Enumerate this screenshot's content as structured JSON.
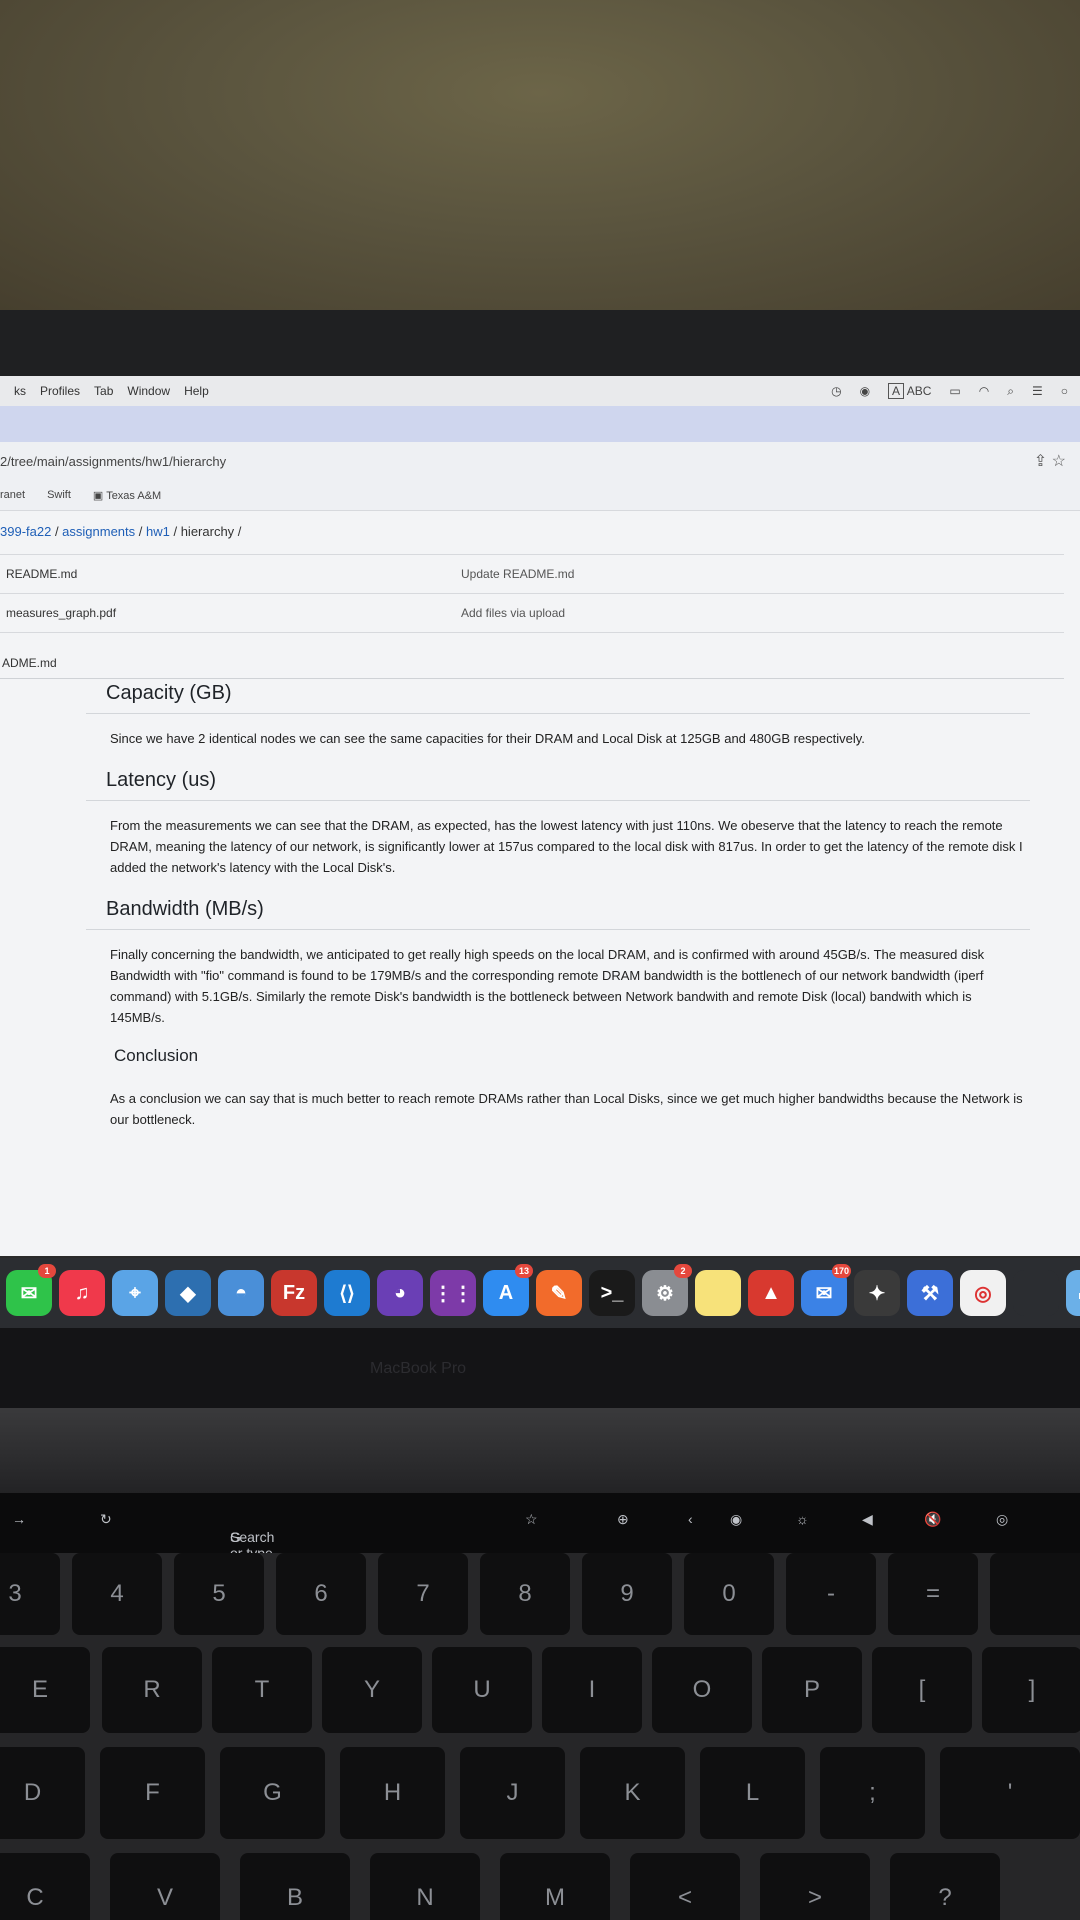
{
  "menubar": {
    "items": [
      "ks",
      "Profiles",
      "Tab",
      "Window",
      "Help"
    ],
    "input_label": "ABC"
  },
  "urlbar": {
    "url": "2/tree/main/assignments/hw1/hierarchy"
  },
  "bookmarks": [
    "ranet",
    "Swift",
    "Texas A&M"
  ],
  "breadcrumb": {
    "repo": "399-fa22",
    "sep1": " / ",
    "part1": "assignments",
    "sep2": " / ",
    "part2": "hw1",
    "sep3": " / ",
    "current": "hierarchy",
    "trail": " /"
  },
  "files": [
    {
      "name": "README.md",
      "message": "Update README.md"
    },
    {
      "name": "measures_graph.pdf",
      "message": "Add files via upload"
    }
  ],
  "readme_header": "ADME.md",
  "readme": {
    "capacity_heading": "Capacity (GB)",
    "capacity_text": "Since we have 2 identical nodes we can see the same capacities for their DRAM and Local Disk at 125GB and 480GB respectively.",
    "latency_heading": "Latency (us)",
    "latency_text": "From the measurements we can see that the DRAM, as expected, has the lowest latency with just 110ns. We obeserve that the latency to reach the remote DRAM, meaning the latency of our network, is significantly lower at 157us compared to the local disk with 817us. In order to get the latency of the remote disk I added the network's latency with the Local Disk's.",
    "bandwidth_heading": "Bandwidth (MB/s)",
    "bandwidth_text": "Finally concerning the bandwidth, we anticipated to get really high speeds on the local DRAM, and is confirmed with around 45GB/s. The measured disk Bandwidth with \"fio\" command is found to be 179MB/s and the corresponding remote DRAM bandwidth is the bottlenech of our network bandwidth (iperf command) with 5.1GB/s. Similarly the remote Disk's bandwidth is the bottleneck between Network bandwith and remote Disk (local) bandwith which is 145MB/s.",
    "conclusion_heading": "Conclusion",
    "conclusion_text": "As a conclusion we can say that is much better to reach remote DRAMs rather than Local Disks, since we get much higher bandwidths because the Network is our bottleneck."
  },
  "dock": {
    "badges": {
      "messages": "1",
      "appstore": "13",
      "chrome_like": "2",
      "mail": "170"
    }
  },
  "laptop_label": "MacBook Pro",
  "touchbar": {
    "search_placeholder": "Search or type URL"
  },
  "keyboard": {
    "row1": [
      "£\n3 #",
      "$\n4",
      "%\n5",
      "^\n6",
      "&\n7",
      "*\n8",
      "(\n9",
      ")\n0",
      "—\n-",
      "+\n="
    ],
    "row2": [
      "E",
      "R",
      "T",
      "Y",
      "U",
      "I",
      "O",
      "P",
      "{\n[",
      "}\n]"
    ],
    "row3": [
      "D",
      "F",
      "G",
      "H",
      "J",
      "K",
      "L",
      ":\n;",
      "\"\n'"
    ],
    "row4": [
      "C",
      "V",
      "B",
      "N",
      "M",
      "<",
      ">",
      "?"
    ]
  },
  "colors": {
    "link": "#1f5fb7",
    "tabstrip": "#cfd6ee"
  }
}
